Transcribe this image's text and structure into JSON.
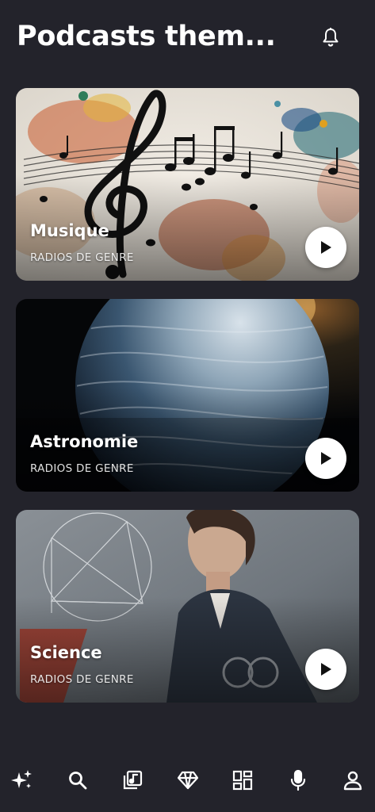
{
  "header": {
    "title": "Podcasts them...",
    "notification_icon": "bell-icon"
  },
  "cards": [
    {
      "title": "Musique",
      "subtitle": "RADIOS DE GENRE",
      "artwork": "music-notes-splash",
      "play_icon": "play-icon"
    },
    {
      "title": "Astronomie",
      "subtitle": "RADIOS DE GENRE",
      "artwork": "planet",
      "play_icon": "play-icon"
    },
    {
      "title": "Science",
      "subtitle": "RADIOS DE GENRE",
      "artwork": "woman-with-geometry",
      "play_icon": "play-icon"
    }
  ],
  "bottom_nav": {
    "items": [
      {
        "icon": "sparkles-icon"
      },
      {
        "icon": "search-icon"
      },
      {
        "icon": "music-library-icon"
      },
      {
        "icon": "diamond-icon"
      },
      {
        "icon": "grid-icon"
      },
      {
        "icon": "microphone-icon"
      },
      {
        "icon": "profile-icon"
      }
    ]
  },
  "colors": {
    "background": "#23232b",
    "text": "#ffffff",
    "play_button": "#ffffff"
  }
}
